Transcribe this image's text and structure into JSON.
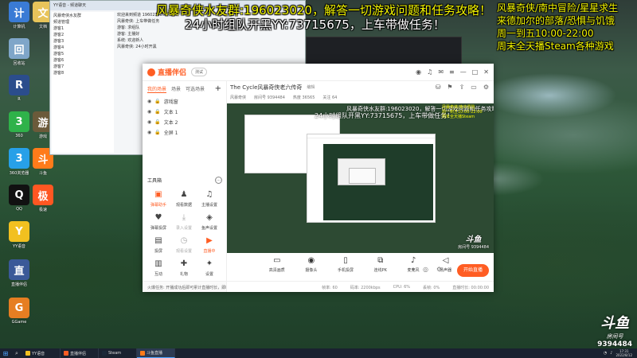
{
  "overlay": {
    "top_text": "风暴奇侠水友群:196023020，解答一切游戏问题和任务攻略！",
    "team_text": "24小时组队开黑YY:73715675，上车带做任务！",
    "right_lines": [
      "风暴奇侠/南中冒险/星星求生",
      "来德加尔的部落/恐惧与饥饿",
      "周一到五10:00-22:00",
      "周末全天播Steam各种游戏"
    ]
  },
  "desktop_icons": [
    {
      "label": "计算机",
      "icon": "computer-icon",
      "color": "#3a7bd5"
    },
    {
      "label": "回收站",
      "icon": "recycle-bin-icon",
      "color": "#7fa6c9"
    },
    {
      "label": "R",
      "icon": "app-r-icon",
      "color": "#2b4d8c"
    },
    {
      "label": "360",
      "icon": "plus-360-icon",
      "color": "#2fb24a"
    },
    {
      "label": "360浏览器",
      "icon": "browser-icon",
      "color": "#27a0e8"
    },
    {
      "label": "QQ",
      "icon": "qq-penguin-icon",
      "color": "#111111"
    },
    {
      "label": "YY语音",
      "icon": "yy-owl-icon",
      "color": "#f2c020"
    },
    {
      "label": "直播伴侣",
      "icon": "shield-icon",
      "color": "#3b5998"
    },
    {
      "label": "GGame",
      "icon": "g-game-icon",
      "color": "#e67e22"
    },
    {
      "label": "文档",
      "icon": "file-icon",
      "color": "#e8c45a"
    },
    {
      "label": "斗鱼",
      "icon": "fish-icon",
      "color": "#ff7b1a"
    },
    {
      "label": "极速",
      "icon": "speed-icon",
      "color": "#ff5722"
    },
    {
      "label": "游戏",
      "icon": "game-thumb-icon",
      "color": "#6b5a3a"
    }
  ],
  "live": {
    "app_name": "直播伴侣",
    "version_pill": "测试",
    "scene_tabs": [
      "我的场景",
      "场景",
      "可选场景"
    ],
    "scenes": [
      "游戏窗",
      "文本 1",
      "文本 2",
      "全屏 1"
    ],
    "tools_title": "工具箱",
    "tools": [
      {
        "label": "弹幕助手",
        "icon": "chat-icon",
        "style": "orange"
      },
      {
        "label": "观看数据",
        "icon": "user-icon",
        "style": ""
      },
      {
        "label": "主播设置",
        "icon": "bell-icon",
        "style": ""
      },
      {
        "label": "弹幕投屏",
        "icon": "heart-hand-icon",
        "style": ""
      },
      {
        "label": "录入设置",
        "icon": "download-icon",
        "style": "grey"
      },
      {
        "label": "鱼声设置",
        "icon": "fish-sound-icon",
        "style": ""
      },
      {
        "label": "投屏",
        "icon": "screen-icon",
        "style": ""
      },
      {
        "label": "观看设置",
        "icon": "timer-icon",
        "style": "grey"
      },
      {
        "label": "直播中",
        "icon": "live-badge-icon",
        "style": "orange"
      },
      {
        "label": "互动",
        "icon": "book-icon",
        "style": ""
      },
      {
        "label": "礼物",
        "icon": "gift-icon",
        "style": ""
      },
      {
        "label": "设置",
        "icon": "puzzle-icon",
        "style": ""
      }
    ],
    "notice": "火爆任务: 开播成功后即可累计直播时长，即时获得奖励",
    "room_title": "The Cycle风暴奇侠老六传奇",
    "room_edit": "编辑",
    "stats": [
      "风暴奇侠",
      "房间号 9394484",
      "热度 36565",
      "关注 64"
    ],
    "preview_overlay_1": "风暴奇侠水友群:196023020，解答一切游戏问题和任务攻略！",
    "preview_overlay_2": "24小时组队开黑YY:73715675，上车带做任务！",
    "preview_overlay_3": [
      "风暴奇侠/南中冒险",
      "周一到五10:00-22:00",
      "周末全天播Steam"
    ],
    "preview_wm": "斗鱼",
    "preview_wm_sub": "房间号 9394484",
    "controls": [
      {
        "label": "高清画质",
        "icon": "monitor-icon"
      },
      {
        "label": "摄像头",
        "icon": "camera-icon"
      },
      {
        "label": "手机投屏",
        "icon": "phone-icon"
      },
      {
        "label": "连线PK",
        "icon": "link-icon"
      },
      {
        "label": "麦克风",
        "icon": "mic-icon"
      },
      {
        "label": "扬声器",
        "icon": "speaker-icon"
      }
    ],
    "status": [
      "帧率: 60",
      "码率: 2200kbps",
      "CPU: 6%",
      "丢帧: 0%",
      "直播时长: 00:00:00"
    ],
    "go_live": "开始直播"
  },
  "chat": {
    "title": "YY语音 - 频道聊天",
    "members": [
      "风暴奇侠水友群",
      "频道管理",
      "游客1",
      "游客2",
      "游客3",
      "游客4",
      "游客5",
      "游客6",
      "游客7",
      "游客8"
    ],
    "messages": [
      "欢迎来到频道 196023020",
      "风暴奇侠: 上车带做任务",
      "游客: 求组队",
      "游客: 主播好",
      "系统: 欢迎新人",
      "风暴奇侠: 24小时开黑"
    ]
  },
  "watermark": {
    "brand": "斗鱼",
    "sub": "房间号",
    "room": "9394484"
  },
  "taskbar": {
    "items": [
      {
        "label": "YY语音",
        "color": "#f2c020",
        "active": false
      },
      {
        "label": "直播伴侣",
        "color": "#ff5d23",
        "active": false
      },
      {
        "label": "Steam",
        "color": "#1b2838",
        "active": false
      },
      {
        "label": "斗鱼直播",
        "color": "#ff7b1a",
        "active": true
      }
    ],
    "time": "17:31",
    "date": "2022/8/12"
  }
}
